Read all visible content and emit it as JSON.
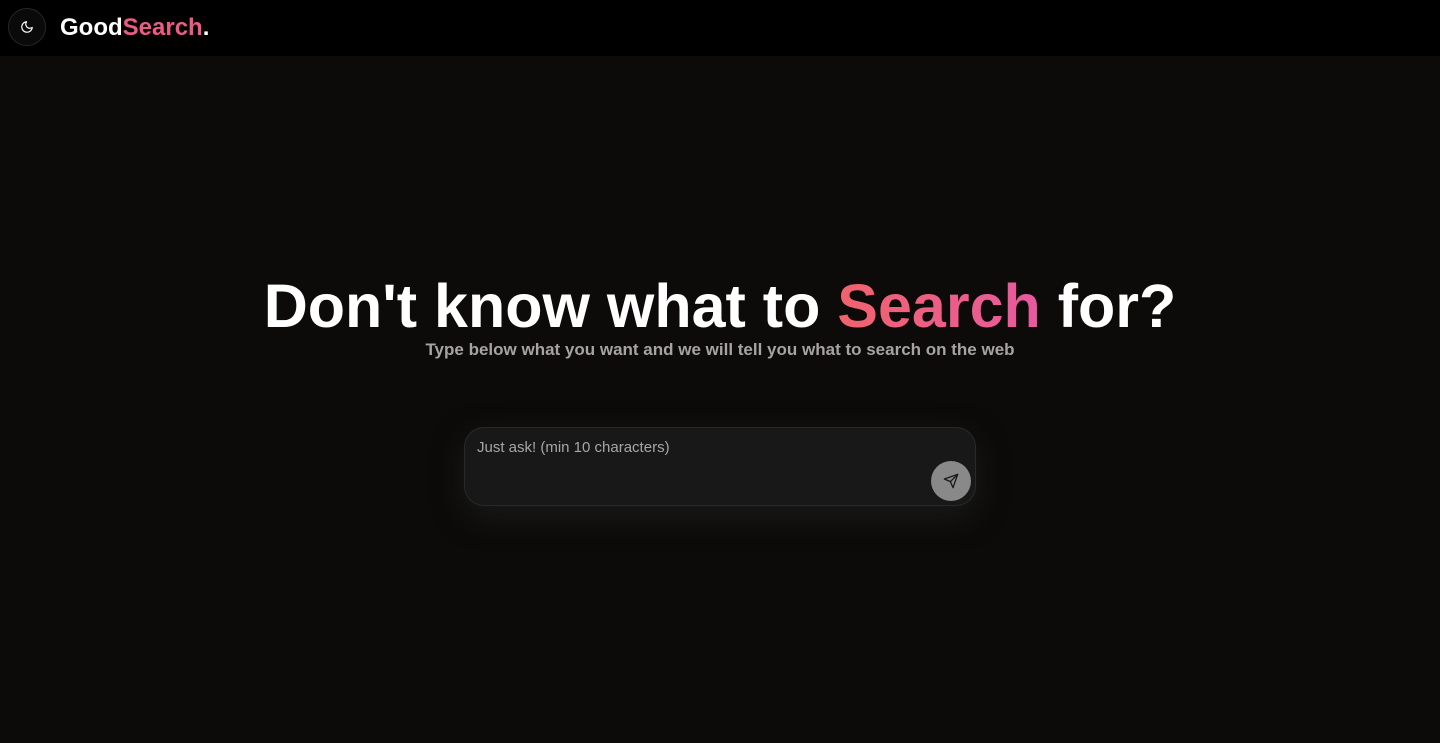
{
  "header": {
    "theme_toggle_icon": "moon-icon",
    "logo": {
      "part1": "Good",
      "part2": "Search",
      "part3": "."
    }
  },
  "hero": {
    "title_before": "Don't know what to ",
    "title_accent": "Search",
    "title_after": " for?",
    "subtitle": "Type below what you want and we will tell you what to search on the web"
  },
  "search": {
    "placeholder": "Just ask! (min 10 characters)",
    "value": "",
    "send_icon": "send-icon"
  },
  "colors": {
    "background": "#0c0b0a",
    "header_background": "#000000",
    "accent_start": "#f1636c",
    "accent_end": "#e75aa0",
    "brand_accent": "#ec5b86",
    "send_button": "#8a8989"
  }
}
